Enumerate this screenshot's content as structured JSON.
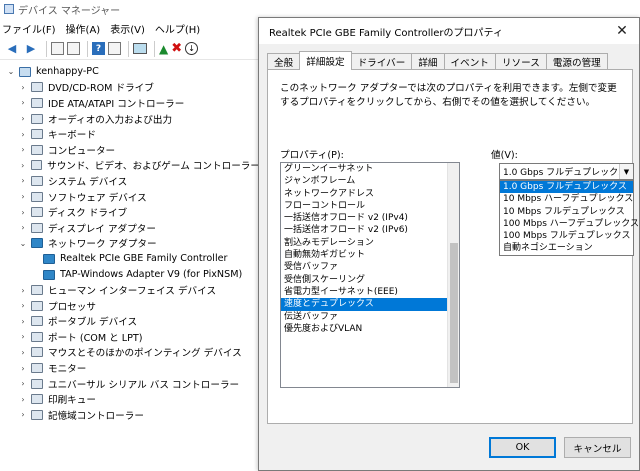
{
  "device_manager": {
    "title": "デバイス マネージャー",
    "menu": [
      "ファイル(F)",
      "操作(A)",
      "表示(V)",
      "ヘルプ(H)"
    ],
    "tree": [
      {
        "label": "kenhappy-PC",
        "expanded": true,
        "level": 0
      },
      {
        "label": "DVD/CD-ROM ドライブ",
        "level": 1
      },
      {
        "label": "IDE ATA/ATAPI コントローラー",
        "level": 1
      },
      {
        "label": "オーディオの入力および出力",
        "level": 1
      },
      {
        "label": "キーボード",
        "level": 1
      },
      {
        "label": "コンピューター",
        "level": 1
      },
      {
        "label": "サウンド、ビデオ、およびゲーム コントローラー",
        "level": 1
      },
      {
        "label": "システム デバイス",
        "level": 1
      },
      {
        "label": "ソフトウェア デバイス",
        "level": 1
      },
      {
        "label": "ディスク ドライブ",
        "level": 1
      },
      {
        "label": "ディスプレイ アダプター",
        "level": 1
      },
      {
        "label": "ネットワーク アダプター",
        "level": 1,
        "expanded": true
      },
      {
        "label": "Realtek PCIe GBE Family Controller",
        "level": 2
      },
      {
        "label": "TAP-Windows Adapter V9 (for PixNSM)",
        "level": 2
      },
      {
        "label": "ヒューマン インターフェイス デバイス",
        "level": 1
      },
      {
        "label": "プロセッサ",
        "level": 1
      },
      {
        "label": "ポータブル デバイス",
        "level": 1
      },
      {
        "label": "ポート (COM と LPT)",
        "level": 1
      },
      {
        "label": "マウスとそのほかのポインティング デバイス",
        "level": 1
      },
      {
        "label": "モニター",
        "level": 1
      },
      {
        "label": "ユニバーサル シリアル バス コントローラー",
        "level": 1
      },
      {
        "label": "印刷キュー",
        "level": 1
      },
      {
        "label": "記憶域コントローラー",
        "level": 1
      }
    ]
  },
  "dialog": {
    "title": "Realtek PCIe GBE Family Controllerのプロパティ",
    "tabs": [
      "全般",
      "詳細設定",
      "ドライバー",
      "詳細",
      "イベント",
      "リソース",
      "電源の管理"
    ],
    "active_tab": "詳細設定",
    "description": "このネットワーク アダプターでは次のプロパティを利用できます。左側で変更するプロパティをクリックしてから、右側でその値を選択してください。",
    "property_label": "プロパティ(P):",
    "value_label": "値(V):",
    "properties": [
      "グリーンイーサネット",
      "ジャンボフレーム",
      "ネットワークアドレス",
      "フローコントロール",
      "一括送信オフロード v2 (IPv4)",
      "一括送信オフロード v2 (IPv6)",
      "割込みモデレーション",
      "自動無効ギガビット",
      "受信バッファ",
      "受信側スケーリング",
      "省電力型イーサネット(EEE)",
      "速度とデュプレックス",
      "伝送バッファ",
      "優先度およびVLAN"
    ],
    "selected_property": "速度とデュプレックス",
    "value_selected": "1.0 Gbps フルデュプレックス",
    "value_options": [
      "1.0 Gbps フルデュプレックス",
      "10 Mbps ハーフデュプレックス",
      "10 Mbps フルデュプレックス",
      "100 Mbps ハーフデュプレックス",
      "100 Mbps フルデュプレックス",
      "自動ネゴシエーション"
    ],
    "ok_label": "OK",
    "cancel_label": "キャンセル",
    "close_glyph": "✕"
  }
}
